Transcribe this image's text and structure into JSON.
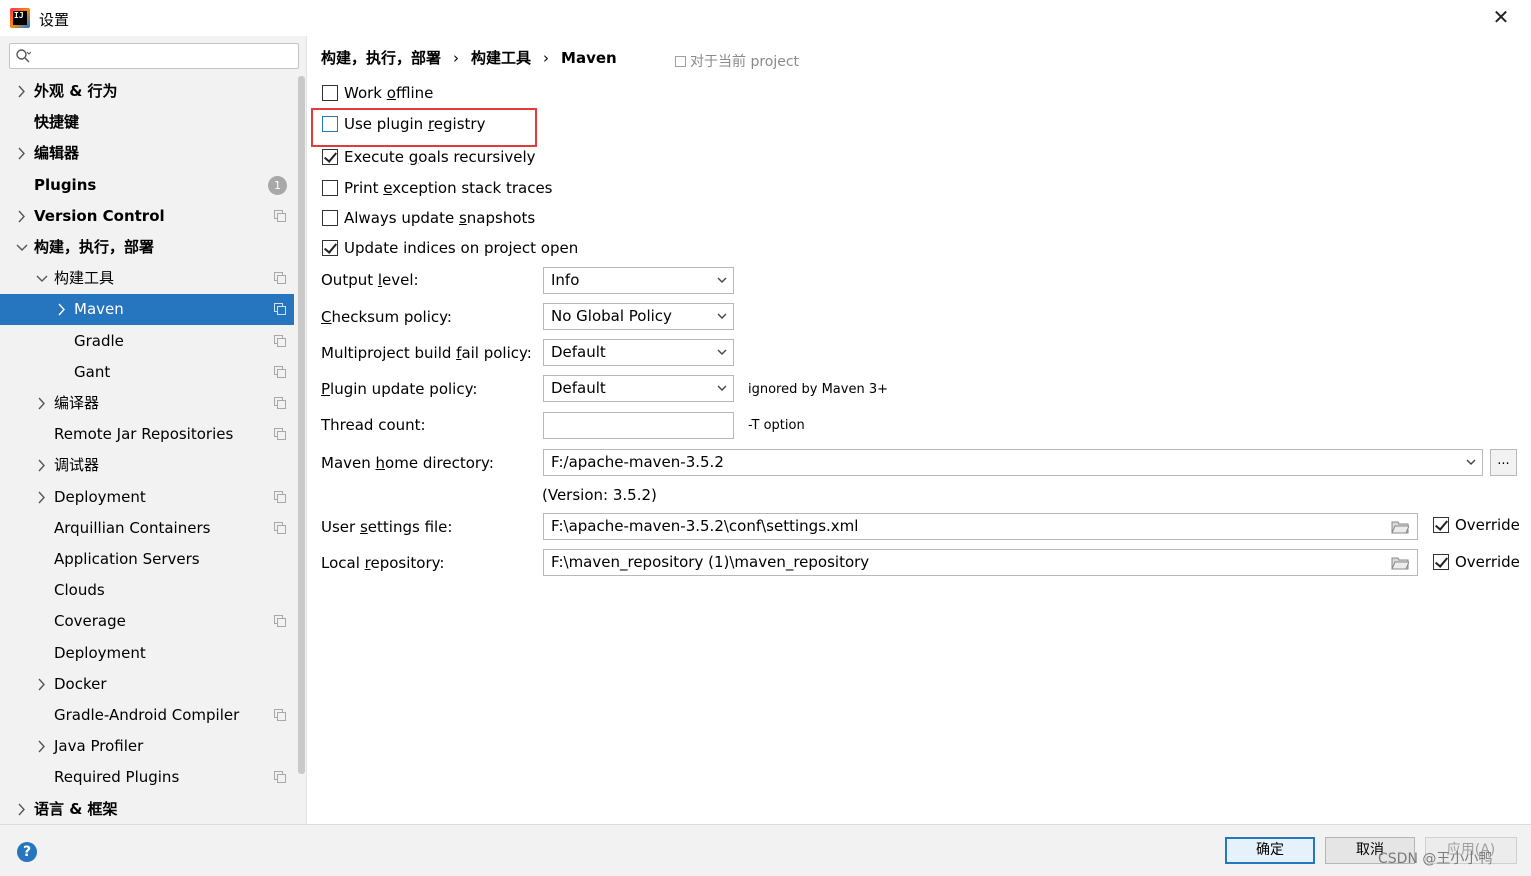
{
  "window": {
    "title": "设置"
  },
  "search": {
    "placeholder": ""
  },
  "sidebar": {
    "items": [
      {
        "label": "外观 & 行为",
        "level": 0,
        "expander": "collapsed",
        "bold": true
      },
      {
        "label": "快捷键",
        "level": 0,
        "expander": "none",
        "bold": true
      },
      {
        "label": "编辑器",
        "level": 0,
        "expander": "collapsed",
        "bold": true
      },
      {
        "label": "Plugins",
        "level": 0,
        "expander": "none",
        "bold": true,
        "badge": "1"
      },
      {
        "label": "Version Control",
        "level": 0,
        "expander": "collapsed",
        "bold": true,
        "copy": true
      },
      {
        "label": "构建，执行，部署",
        "level": 0,
        "expander": "expanded",
        "bold": true
      },
      {
        "label": "构建工具",
        "level": 1,
        "expander": "expanded",
        "copy": true
      },
      {
        "label": "Maven",
        "level": 2,
        "expander": "collapsed",
        "copy": true,
        "selected": true
      },
      {
        "label": "Gradle",
        "level": 2,
        "expander": "none",
        "copy": true
      },
      {
        "label": "Gant",
        "level": 2,
        "expander": "none",
        "copy": true
      },
      {
        "label": "编译器",
        "level": 1,
        "expander": "collapsed",
        "copy": true
      },
      {
        "label": "Remote Jar Repositories",
        "level": 1,
        "expander": "none",
        "copy": true
      },
      {
        "label": "调试器",
        "level": 1,
        "expander": "collapsed"
      },
      {
        "label": "Deployment",
        "level": 1,
        "expander": "collapsed",
        "copy": true
      },
      {
        "label": "Arquillian Containers",
        "level": 1,
        "expander": "none",
        "copy": true
      },
      {
        "label": "Application Servers",
        "level": 1,
        "expander": "none"
      },
      {
        "label": "Clouds",
        "level": 1,
        "expander": "none"
      },
      {
        "label": "Coverage",
        "level": 1,
        "expander": "none",
        "copy": true
      },
      {
        "label": "Deployment",
        "level": 1,
        "expander": "none"
      },
      {
        "label": "Docker",
        "level": 1,
        "expander": "collapsed"
      },
      {
        "label": "Gradle-Android Compiler",
        "level": 1,
        "expander": "none",
        "copy": true
      },
      {
        "label": "Java Profiler",
        "level": 1,
        "expander": "collapsed"
      },
      {
        "label": "Required Plugins",
        "level": 1,
        "expander": "none",
        "copy": true
      },
      {
        "label": "语言 & 框架",
        "level": 0,
        "expander": "collapsed",
        "bold": true
      }
    ]
  },
  "breadcrumb": {
    "part1": "构建，执行，部署",
    "sep": "›",
    "part2": "构建工具",
    "part3": "Maven"
  },
  "scope": {
    "label": "对于当前 project"
  },
  "checkboxes": {
    "work_offline": {
      "pre": "Work ",
      "mn": "o",
      "post": "ffline",
      "checked": false
    },
    "use_plugin_registry": {
      "pre": "Use plugin ",
      "mn": "r",
      "post": "egistry",
      "checked": false
    },
    "execute_goals": {
      "pre": "Execute ",
      "mn": "g",
      "post": "oals recursively",
      "checked": true
    },
    "print_exception": {
      "pre": "Print ",
      "mn": "e",
      "post": "xception stack traces",
      "checked": false
    },
    "always_update": {
      "pre": "Always update ",
      "mn": "s",
      "post": "napshots",
      "checked": false
    },
    "update_indices": {
      "pre": "Update indices on project open",
      "mn": "",
      "post": "",
      "checked": true
    }
  },
  "form": {
    "output_level": {
      "pre": "Output ",
      "mn": "l",
      "post": "evel:",
      "value": "Info"
    },
    "checksum_policy": {
      "pre": "",
      "mn": "C",
      "post": "hecksum policy:",
      "value": "No Global Policy"
    },
    "multiproject_policy": {
      "pre": "Multiproject build ",
      "mn": "f",
      "post": "ail policy:",
      "value": "Default"
    },
    "plugin_update_policy": {
      "pre": "",
      "mn": "P",
      "post": "lugin update policy:",
      "value": "Default",
      "hint": "ignored by Maven 3+"
    },
    "thread_count": {
      "label": "Thread count:",
      "value": "",
      "hint": "-T option"
    },
    "maven_home": {
      "pre": "Maven ",
      "mn": "h",
      "post": "ome directory:",
      "value": "F:/apache-maven-3.5.2",
      "browse": "...",
      "version": "(Version: 3.5.2)"
    },
    "user_settings": {
      "pre": "User ",
      "mn": "s",
      "post": "ettings file:",
      "value": "F:\\apache-maven-3.5.2\\conf\\settings.xml",
      "override": "Override",
      "override_checked": true
    },
    "local_repo": {
      "pre": "Local ",
      "mn": "r",
      "post": "epository:",
      "value": "F:\\maven_repository (1)\\maven_repository",
      "override": "Override",
      "override_checked": true
    }
  },
  "buttons": {
    "ok": "确定",
    "cancel": "取消",
    "apply": "应用(A)",
    "help": "?"
  },
  "watermark": "CSDN @王小小鸭",
  "colors": {
    "selection": "#2675bf",
    "highlight": "#e13b3b",
    "sidebar_bg": "#f2f2f2"
  },
  "icons": {
    "close": "close-icon",
    "search": "search-icon",
    "copy": "copy-icon",
    "folder": "folder-icon",
    "chevron": "chevron-icon",
    "help": "help-icon"
  }
}
